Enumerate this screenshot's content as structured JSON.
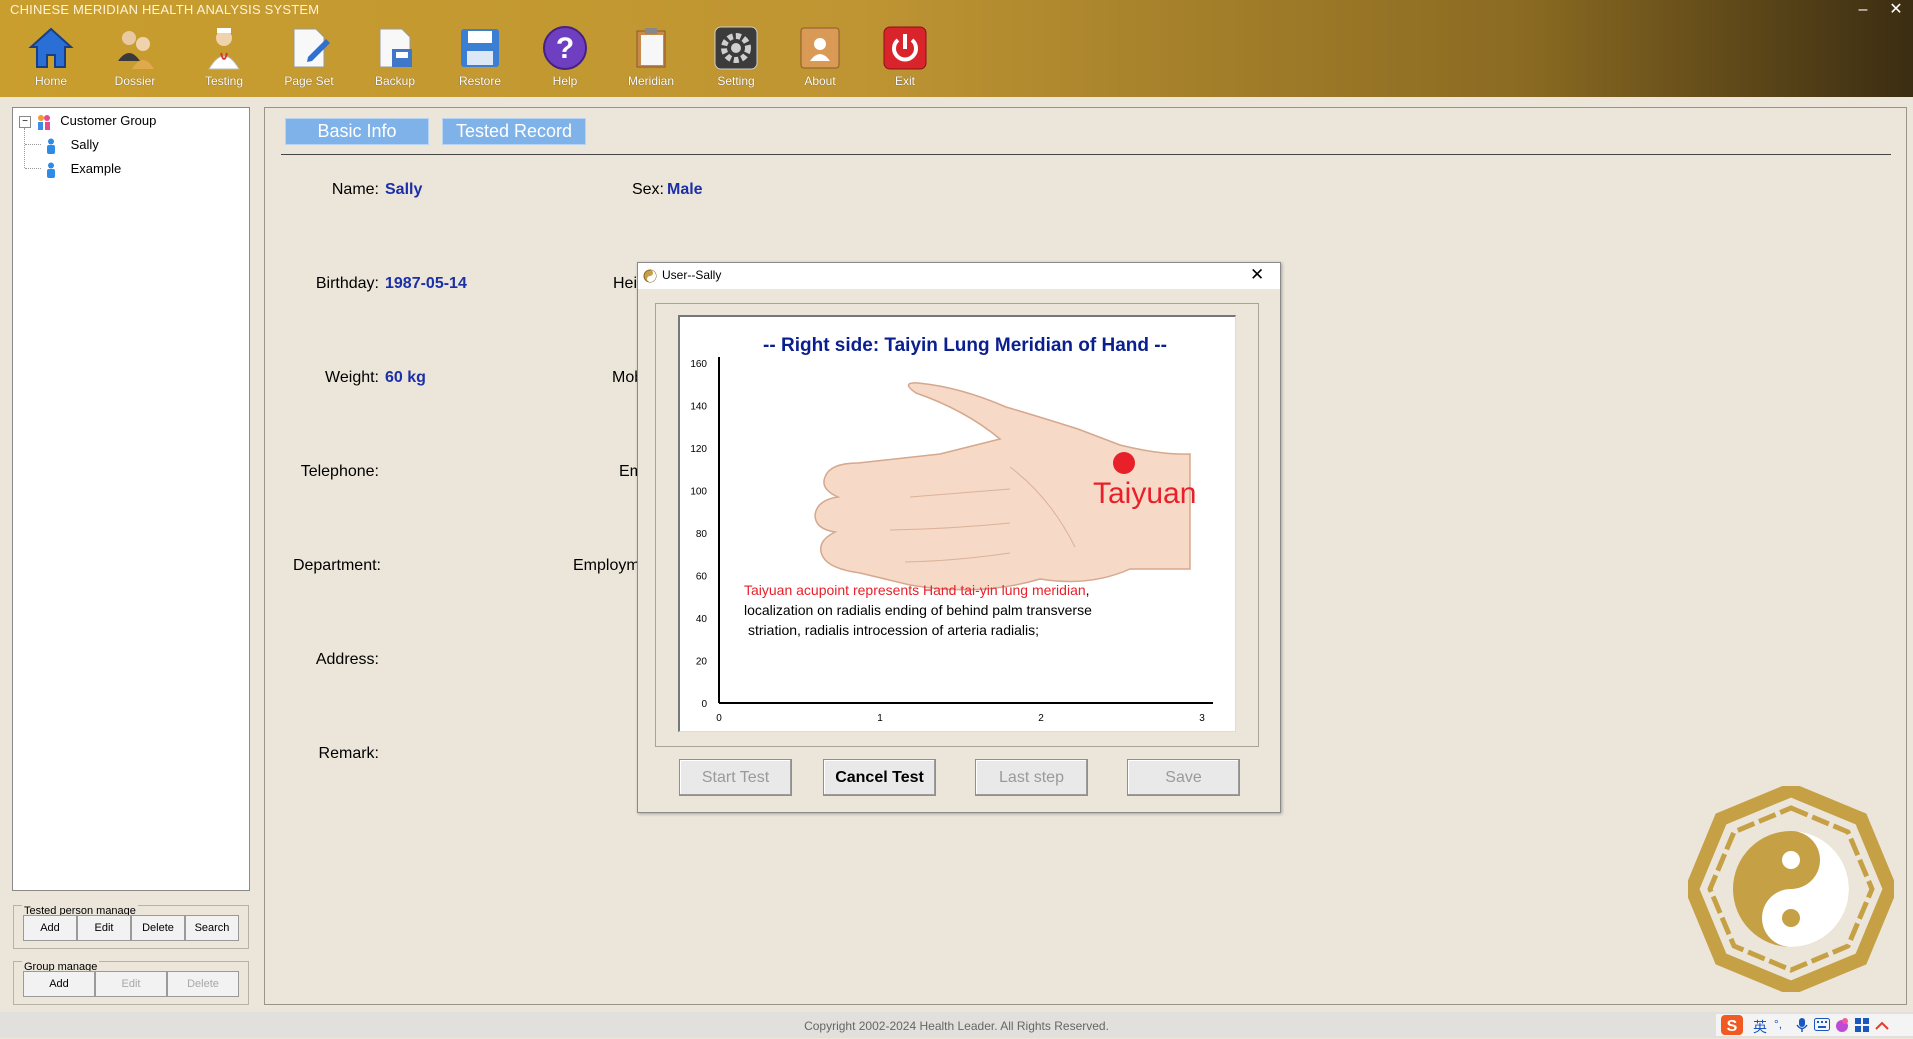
{
  "app": {
    "title": "CHINESE MERIDIAN HEALTH ANALYSIS SYSTEM"
  },
  "toolbar": {
    "items": [
      {
        "label": "Home",
        "icon": "home-icon"
      },
      {
        "label": "Dossier",
        "icon": "people-icon"
      },
      {
        "label": "Testing",
        "icon": "doctor-icon"
      },
      {
        "label": "Page Set",
        "icon": "page-edit-icon"
      },
      {
        "label": "Backup",
        "icon": "backup-icon"
      },
      {
        "label": "Restore",
        "icon": "floppy-icon"
      },
      {
        "label": "Help",
        "icon": "help-icon"
      },
      {
        "label": "Meridian",
        "icon": "clipboard-icon"
      },
      {
        "label": "Setting",
        "icon": "gear-icon"
      },
      {
        "label": "About",
        "icon": "about-icon"
      },
      {
        "label": "Exit",
        "icon": "power-icon"
      }
    ],
    "minimize": "–",
    "close": "✕"
  },
  "tree": {
    "root": "Customer Group",
    "children": [
      "Sally",
      "Example"
    ]
  },
  "tested_person_manage": {
    "title": "Tested person manage",
    "buttons": [
      "Add",
      "Edit",
      "Delete",
      "Search"
    ]
  },
  "group_manage": {
    "title": "Group manage",
    "buttons": [
      "Add",
      "Edit",
      "Delete"
    ]
  },
  "tabs": [
    "Basic Info",
    "Tested Record"
  ],
  "form": {
    "name_label": "Name:",
    "name_value": "Sally",
    "sex_label": "Sex:",
    "sex_value": "Male",
    "birthday_label": "Birthday:",
    "birthday_value": "1987-05-14",
    "height_label": "Hei",
    "weight_label": "Weight:",
    "weight_value": "60 kg",
    "mobile_label": "Mob",
    "telephone_label": "Telephone:",
    "email_label": "Em",
    "department_label": "Department:",
    "employment_label": "Employm",
    "address_label": "Address:",
    "remark_label": "Remark:"
  },
  "dialog": {
    "title": "User--Sally",
    "close": "✕",
    "buttons": [
      {
        "label": "Start Test",
        "enabled": false
      },
      {
        "label": "Cancel Test",
        "enabled": true
      },
      {
        "label": "Last step",
        "enabled": false
      },
      {
        "label": "Save",
        "enabled": false
      }
    ]
  },
  "chart_data": {
    "type": "line",
    "title": "-- Right side: Taiyin Lung Meridian of Hand --",
    "xlabel": "",
    "ylabel": "",
    "x_ticks": [
      "0",
      "1",
      "2",
      "3"
    ],
    "y_ticks": [
      "0",
      "20",
      "40",
      "60",
      "80",
      "100",
      "120",
      "140",
      "160"
    ],
    "xlim": [
      0,
      3
    ],
    "ylim": [
      0,
      160
    ],
    "series": [],
    "annotations": {
      "acupoint": "Taiyuan",
      "desc_red": "Taiyuan acupoint represents Hand tai-yin lung meridian",
      "desc_comma": ",",
      "desc_line2": "localization on radialis ending of behind palm transverse",
      "desc_line3": "striation, radialis introcession of arteria radialis;"
    }
  },
  "footer": {
    "copyright": "Copyright 2002-2024 Health Leader.  All Rights Reserved."
  },
  "tray": {
    "ime": "英",
    "punct": "°,"
  },
  "colors": {
    "toolbar_gold": "#c99e2e",
    "tab_blue": "#7fb2e8",
    "value_blue": "#1b2fa8",
    "acupoint_red": "#e8202a",
    "chart_title": "#0a1f8f",
    "bagua_gold": "#c6a045"
  }
}
